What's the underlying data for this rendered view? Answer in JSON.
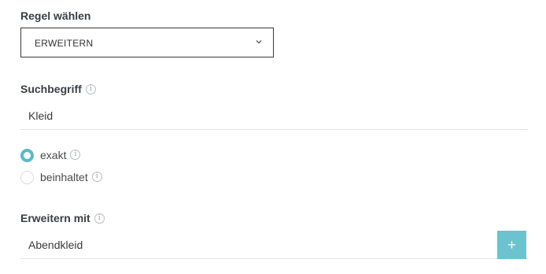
{
  "rule": {
    "label": "Regel wählen",
    "selected_value": "ERWEITERN"
  },
  "search_term": {
    "label": "Suchbegriff",
    "value": "Kleid"
  },
  "match_mode": {
    "options": [
      {
        "label": "exakt",
        "checked": true
      },
      {
        "label": "beinhaltet",
        "checked": false
      }
    ]
  },
  "extend_with": {
    "label": "Erweitern mit",
    "value": "Abendkleid",
    "add_button": "+"
  },
  "icons": {
    "info": "i"
  },
  "colors": {
    "accent": "#6cc3cf",
    "radio_checked": "#5bbac9"
  }
}
